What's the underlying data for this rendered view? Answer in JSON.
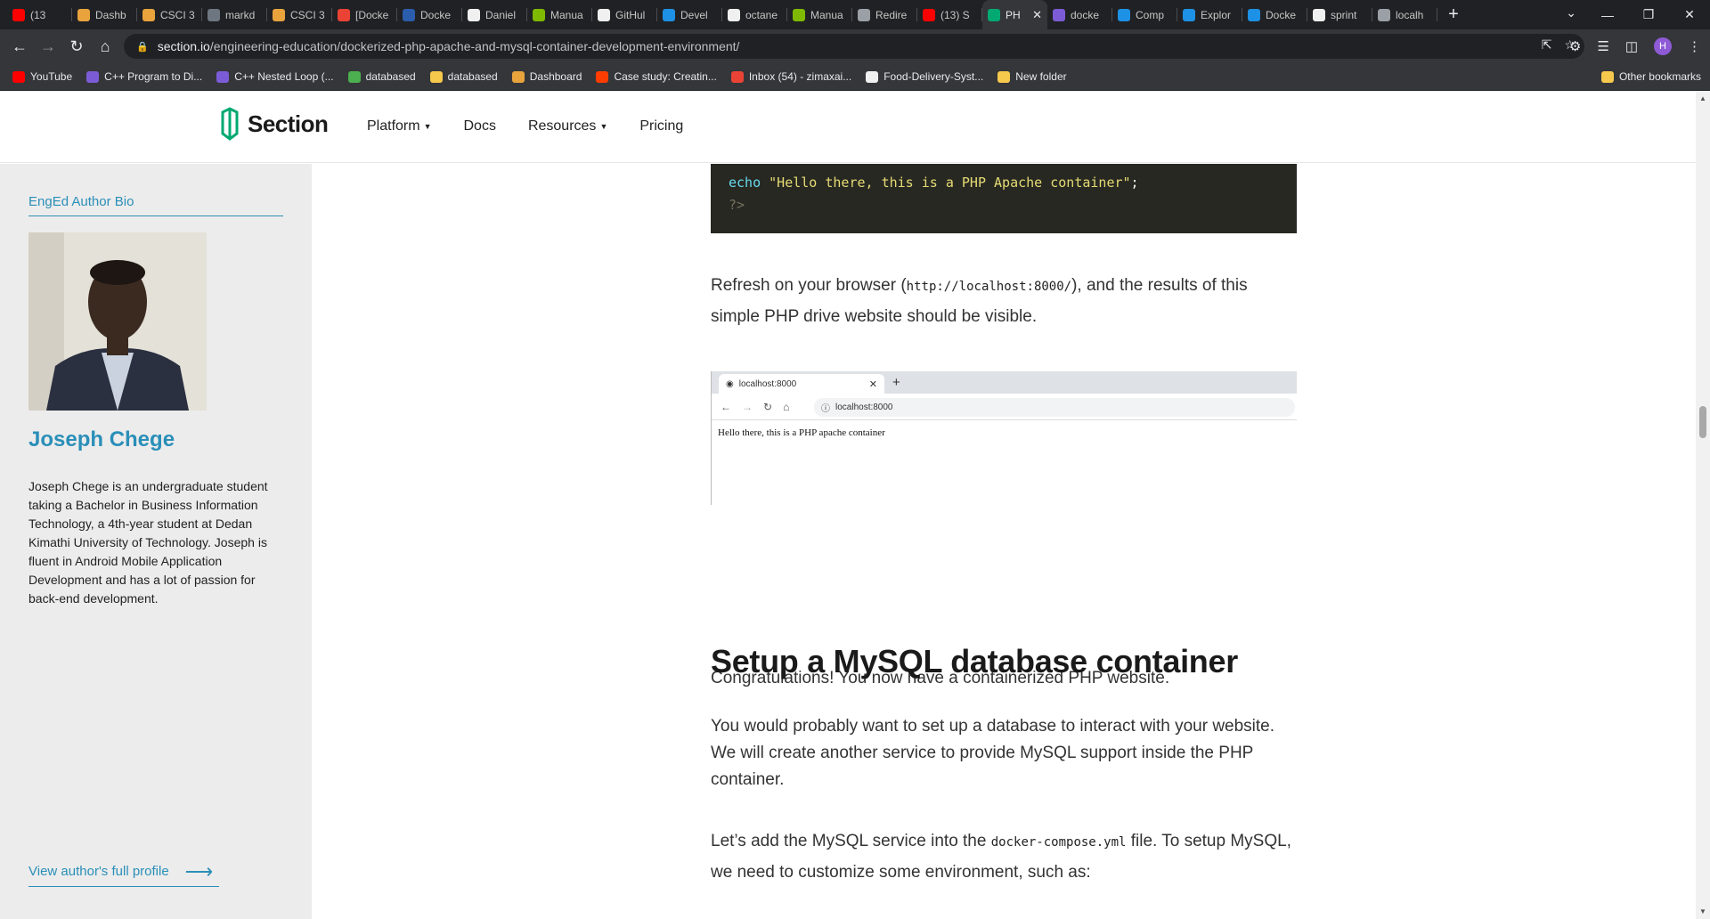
{
  "browser": {
    "tabs": [
      {
        "label": "(13",
        "color": "#ff0000"
      },
      {
        "label": "Dashb",
        "color": "#e8a33d"
      },
      {
        "label": "CSCI 3",
        "color": "#e8a33d"
      },
      {
        "label": "markd",
        "color": "#6e7681"
      },
      {
        "label": "CSCI 3",
        "color": "#e8a33d"
      },
      {
        "label": "[Docke",
        "color": "#ea4335"
      },
      {
        "label": "Docke",
        "color": "#2a5dac"
      },
      {
        "label": "Daniel",
        "color": "#f0f0f0"
      },
      {
        "label": "Manua",
        "color": "#7fba00"
      },
      {
        "label": "GitHul",
        "color": "#f0f0f0"
      },
      {
        "label": "Devel",
        "color": "#1d91e6"
      },
      {
        "label": "octane",
        "color": "#f0f0f0"
      },
      {
        "label": "Manua",
        "color": "#7fba00"
      },
      {
        "label": "Redire",
        "color": "#9aa0a6"
      },
      {
        "label": "(13) S",
        "color": "#ff0000"
      },
      {
        "label": "PH",
        "color": "#00a971"
      },
      {
        "label": "docke",
        "color": "#7c5cd6"
      },
      {
        "label": "Comp",
        "color": "#1d91e6"
      },
      {
        "label": "Explor",
        "color": "#1d91e6"
      },
      {
        "label": "Docke",
        "color": "#1d91e6"
      },
      {
        "label": "sprint",
        "color": "#f0f0f0"
      },
      {
        "label": "localh",
        "color": "#9aa0a6"
      }
    ],
    "active_tab_index": 15,
    "new_tab": "+",
    "address": {
      "host": "section.io",
      "path": "/engineering-education/dockerized-php-apache-and-mysql-container-development-environment/"
    },
    "profile_initial": "H",
    "bookmarks": [
      {
        "label": "YouTube",
        "color": "#ff0000"
      },
      {
        "label": "C++ Program to Di...",
        "color": "#7c5cd6"
      },
      {
        "label": "C++ Nested Loop (...",
        "color": "#7c5cd6"
      },
      {
        "label": "databased",
        "color": "#4caf50"
      },
      {
        "label": "databased",
        "color": "#f6c94c"
      },
      {
        "label": "Dashboard",
        "color": "#e8a33d"
      },
      {
        "label": "Case study: Creatin...",
        "color": "#ff3d00"
      },
      {
        "label": "Inbox (54) - zimaxai...",
        "color": "#ea4335"
      },
      {
        "label": "Food-Delivery-Syst...",
        "color": "#f0f0f0"
      },
      {
        "label": "New folder",
        "color": "#f6c94c"
      }
    ],
    "other_bookmarks": "Other bookmarks"
  },
  "site": {
    "logo_text": "Section",
    "brand_color": "#00a971",
    "nav": {
      "platform": "Platform",
      "docs": "Docs",
      "resources": "Resources",
      "pricing": "Pricing"
    }
  },
  "sidebar": {
    "bio_label": "EngEd Author Bio",
    "author_name": "Joseph Chege",
    "author_bio": "Joseph Chege is an undergraduate student taking a Bachelor in Business Information Technology, a 4th-year student at Dedan Kimathi University of Technology. Joseph is fluent in Android Mobile Application Development and has a lot of passion for back-end development.",
    "profile_link": "View author's full profile",
    "accent": "#2a8fb8"
  },
  "article": {
    "code": {
      "keyword": "echo",
      "string": "\"Hello there, this is a PHP Apache container\"",
      "terminator": ";",
      "close_tag": "?>"
    },
    "refresh_before": "Refresh on your browser (",
    "refresh_code": "http://localhost:8000/",
    "refresh_after": "), and the results of this simple PHP drive website should be visible.",
    "screenshot": {
      "tab_title": "localhost:8000",
      "url": "localhost:8000",
      "body_text": "Hello there, this is a PHP apache container"
    },
    "congrats": "Congratulations! You now have a containerized PHP website.",
    "heading": "Setup a MySQL database container",
    "db_para": "You would probably want to set up a database to interact with your website. We will create another service to provide MySQL support inside the PHP container.",
    "compose_before": "Let’s add the MySQL service into the ",
    "compose_code": "docker-compose.yml",
    "compose_after": " file. To setup MySQL, we need to customize some environment, such as:"
  }
}
